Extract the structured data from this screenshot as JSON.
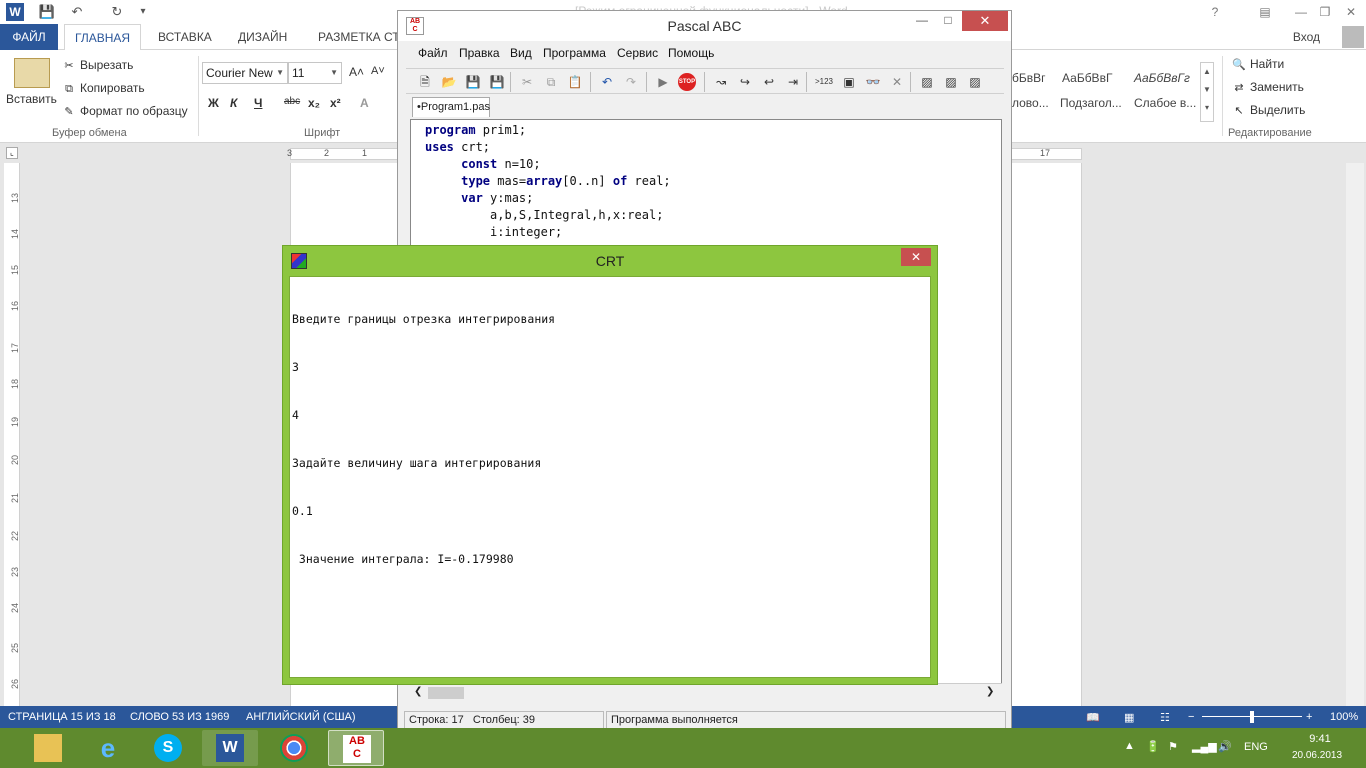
{
  "word": {
    "doc_title_fragment": "[Режим ограниченной функциональности] - Word",
    "tabs": [
      "ФАЙЛ",
      "ГЛАВНАЯ",
      "ВСТАВКА",
      "ДИЗАЙН",
      "РАЗМЕТКА СТ"
    ],
    "sign_in": "Вход",
    "ribbon": {
      "paste_label": "Вставить",
      "cut": "Вырезать",
      "copy": "Копировать",
      "format_painter": "Формат по образцу",
      "clipboard_group": "Буфер обмена",
      "font_name": "Courier New",
      "font_size": "11",
      "font_group": "Шрифт",
      "bold": "Ж",
      "italic": "К",
      "underline": "Ч",
      "strike": "abc",
      "subscript": "x₂",
      "superscript": "x²",
      "grow": "A˄",
      "shrink": "A˅",
      "style_previews": [
        "бБвВг",
        "АаБбВвГ",
        "АаБбВвГг"
      ],
      "style_names": [
        "лово...",
        "Подзагол...",
        "Слабое в..."
      ],
      "find": "Найти",
      "replace": "Заменить",
      "select": "Выделить",
      "editing_group": "Редактирование"
    },
    "ruler_left": [
      "3",
      "2",
      "1"
    ],
    "ruler_right": "17",
    "vruler": [
      "13",
      "14",
      "15",
      "16",
      "17",
      "18",
      "19",
      "20",
      "21",
      "22",
      "23",
      "24",
      "25",
      "26"
    ],
    "status": {
      "page": "СТРАНИЦА 15 ИЗ 18",
      "words": "СЛОВО 53 ИЗ 1969",
      "lang": "АНГЛИЙСКИЙ (США)",
      "zoom": "100%"
    }
  },
  "pascal": {
    "title": "Pascal ABC",
    "menu": [
      "Файл",
      "Правка",
      "Вид",
      "Программа",
      "Сервис",
      "Помощь"
    ],
    "tab": "•Program1.pas",
    "code_lines": [
      "program prim1;",
      "uses crt;",
      "     const n=10;",
      "     type mas=array[0..n] of real;",
      "     var y:mas;",
      "         a,b,S,Integral,h,x:real;",
      "         i:integer;"
    ],
    "status": {
      "row": "Строка: 17",
      "col": "Столбец: 39",
      "state": "Программа выполняется"
    }
  },
  "crt": {
    "title": "CRT",
    "lines": [
      "Введите границы отрезка интегрирования",
      "3",
      "4",
      "Задайте величину шага интегрирования",
      "0.1",
      " Значение интеграла: I=-0.179980"
    ]
  },
  "taskbar": {
    "lang": "ENG",
    "time": "9:41",
    "date": "20.06.2013",
    "apps": [
      "explorer",
      "internet-explorer",
      "skype",
      "word",
      "chrome",
      "pascal-abc"
    ]
  },
  "colors": {
    "word_blue": "#2b579a",
    "crt_green": "#8dc63f",
    "taskbar_green": "#5f8a2e",
    "close_red": "#c75050"
  }
}
